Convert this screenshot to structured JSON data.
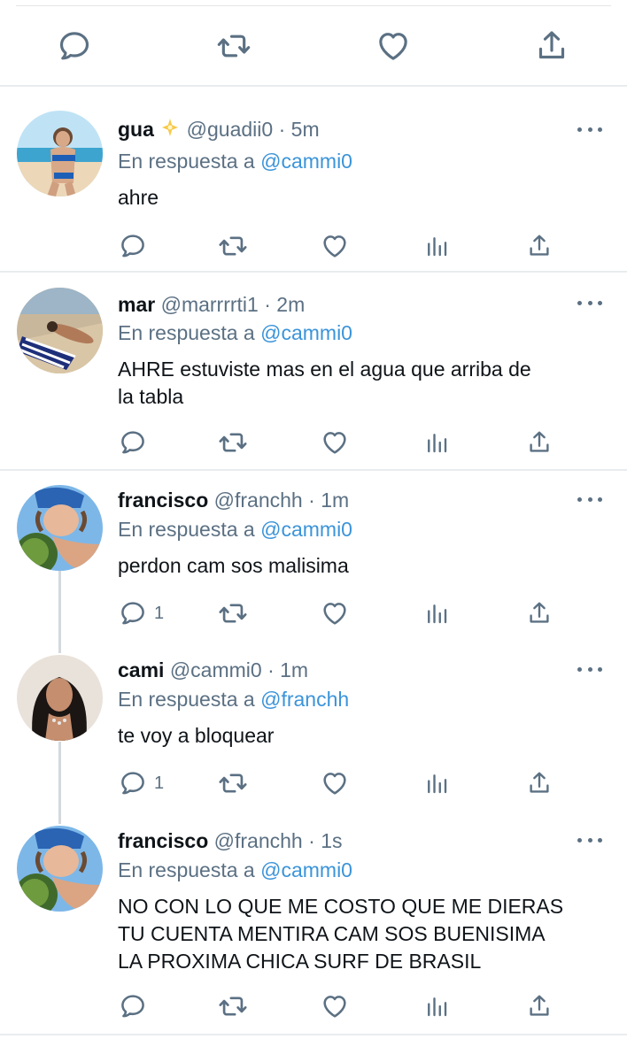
{
  "colors": {
    "mention": "#3b94d9",
    "secondary": "#5b7083",
    "text": "#0f1419"
  },
  "top_actions": [
    "reply-icon",
    "retweet-icon",
    "like-icon",
    "share-icon"
  ],
  "tweets": [
    {
      "name": "gua",
      "name_emoji": "sparkle-star-icon",
      "handle": "@guadii0",
      "dot": "·",
      "time": "5m",
      "reply_prefix": "En respuesta a",
      "reply_to": "@cammi0",
      "lines": [
        "ahre"
      ],
      "reply_count": ""
    },
    {
      "name": "mar",
      "handle": "@marrrrti1",
      "dot": "·",
      "time": "2m",
      "reply_prefix": "En respuesta a",
      "reply_to": "@cammi0",
      "lines": [
        "AHRE estuviste mas en el agua que arriba de",
        "la tabla"
      ],
      "reply_count": ""
    },
    {
      "name": "francisco",
      "handle": "@franchh",
      "dot": "·",
      "time": "1m",
      "reply_prefix": "En respuesta a",
      "reply_to": "@cammi0",
      "lines": [
        "perdon cam sos malisima"
      ],
      "reply_count": "1"
    },
    {
      "name": "cami",
      "handle": "@cammi0",
      "dot": "·",
      "time": "1m",
      "reply_prefix": "En respuesta a",
      "reply_to": "@franchh",
      "lines": [
        "te voy a bloquear"
      ],
      "reply_count": "1"
    },
    {
      "name": "francisco",
      "handle": "@franchh",
      "dot": "·",
      "time": "1s",
      "reply_prefix": "En respuesta a",
      "reply_to": "@cammi0",
      "lines": [
        "NO CON LO QUE ME COSTO QUE ME DIERAS",
        "TU CUENTA MENTIRA CAM SOS BUENISIMA",
        "LA PROXIMA  CHICA SURF DE BRASIL"
      ],
      "reply_count": ""
    }
  ]
}
